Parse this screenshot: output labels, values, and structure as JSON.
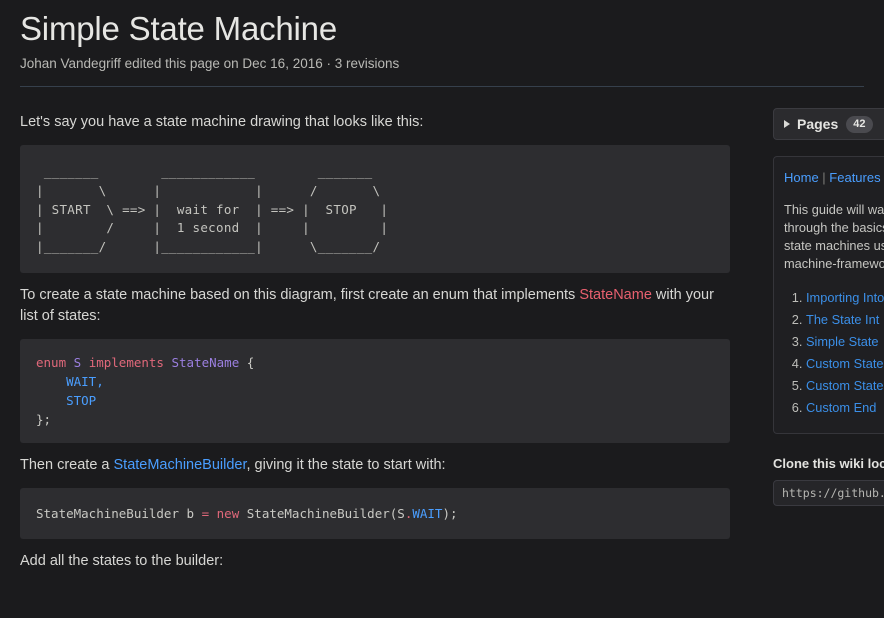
{
  "header": {
    "title": "Simple State Machine",
    "byline": "Johan Vandegriff edited this page on Dec 16, 2016 · 3 revisions"
  },
  "main": {
    "intro_paragraph": "Let's say you have a state machine drawing that looks like this:",
    "diagram_ascii": " _______        ____________        _______\n|       \\      |            |      /       \\\n| START  \\ ==> |  wait for  | ==> |  STOP   |\n|        /     |  1 second  |     |         |\n|_______/      |____________|      \\_______/",
    "para2_before": "To create a state machine based on this diagram, first create an enum that implements ",
    "para2_link": "StateName",
    "para2_after": " with your list of states:",
    "enum_code": {
      "line1_kw": "enum",
      "line1_name": "S",
      "line1_kw2": "implements",
      "line1_type": "StateName",
      "line1_brace": "{",
      "line2": "WAIT,",
      "line3": "STOP",
      "line4": "};"
    },
    "para3_before": "Then create a ",
    "para3_link": "StateMachineBuilder",
    "para3_after": ", giving it the state to start with:",
    "builder_code": {
      "type": "StateMachineBuilder",
      "var": "b",
      "eq": "=",
      "new_kw": "new",
      "ctor": "StateMachineBuilder",
      "arg_enum": "S",
      "dot": ".",
      "arg_const": "WAIT",
      "tail": ");"
    },
    "para4": "Add all the states to the builder:"
  },
  "sidebar": {
    "pages_label": "Pages",
    "pages_count": "42",
    "nav_home": "Home",
    "nav_sep": " | ",
    "nav_features": "Features",
    "intro": "This guide will walk you through the basics of creating state machines using the state-machine-framework.",
    "toc": [
      {
        "n": "1.",
        "label": "Importing Into"
      },
      {
        "n": "2.",
        "label": "The State Int"
      },
      {
        "n": "3.",
        "label": "Simple State"
      },
      {
        "n": "4.",
        "label": "Custom State"
      },
      {
        "n": "5.",
        "label": "Custom State"
      },
      {
        "n": "6.",
        "label": "Custom End"
      }
    ],
    "clone_title": "Clone this wiki locally",
    "clone_url": "https://github.com/"
  },
  "colors": {
    "page_bg": "#1b1b1d",
    "code_bg": "#2d2d30",
    "link_blue": "#4a9eff",
    "link_pink": "#e8606f",
    "keyword_red": "#e0687a",
    "type_purple": "#9b7fe0",
    "const_blue": "#4a9eff",
    "rule": "#36404c"
  }
}
